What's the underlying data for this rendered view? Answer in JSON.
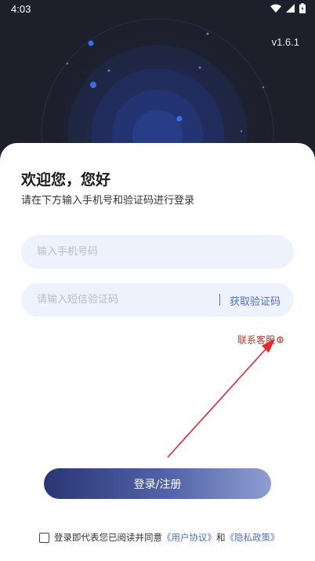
{
  "status": {
    "time": "4:03"
  },
  "hero": {
    "version": "v1.6.1"
  },
  "login": {
    "title": "欢迎您，您好",
    "subtitle": "请在下方输入手机号和验证码进行登录",
    "phone_placeholder": "输入手机号码",
    "code_placeholder": "请输入短信验证码",
    "get_code_label": "获取验证码",
    "service_label": "联系客服",
    "submit_label": "登录/注册"
  },
  "agreement": {
    "prefix": "登录即代表您已阅读并同意",
    "user_agreement": "《用户协议》",
    "conjunction": "和",
    "privacy_policy": "《隐私政策》"
  },
  "colors": {
    "accent": "#4e6fcb",
    "annotation": "#e8262e",
    "service": "#c0392b"
  }
}
